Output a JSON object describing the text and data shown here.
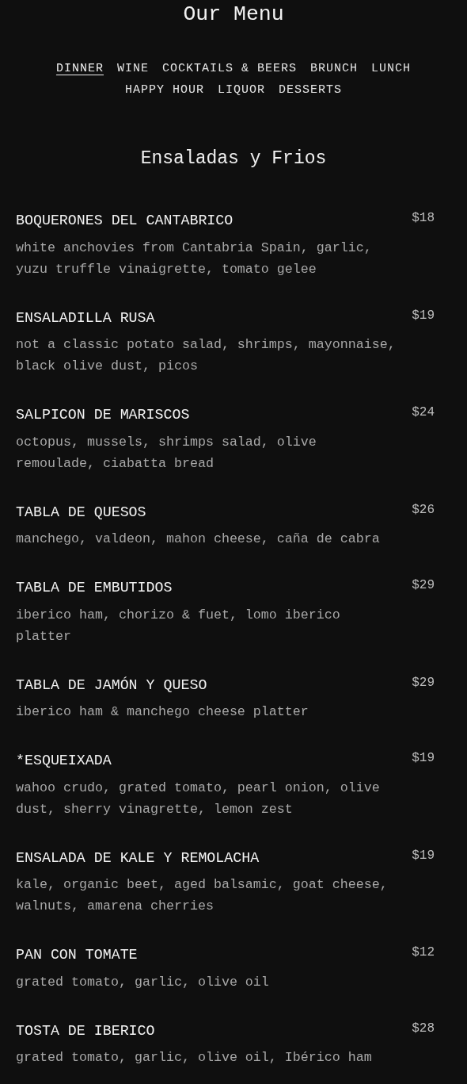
{
  "title": "Our Menu",
  "tabs": [
    {
      "label": "DINNER",
      "selected": true
    },
    {
      "label": "WINE",
      "selected": false
    },
    {
      "label": "COCKTAILS & BEERS",
      "selected": false
    },
    {
      "label": "BRUNCH",
      "selected": false
    },
    {
      "label": "LUNCH",
      "selected": false
    },
    {
      "label": "HAPPY HOUR",
      "selected": false
    },
    {
      "label": "LIQUOR",
      "selected": false
    },
    {
      "label": "DESSERTS",
      "selected": false
    }
  ],
  "section": {
    "heading": "Ensaladas y Frios",
    "items": [
      {
        "name": "BOQUERONES DEL CANTABRICO",
        "price": "$18",
        "description": "white anchovies from Cantabria Spain, garlic, yuzu truffle vinaigrette, tomato gelee"
      },
      {
        "name": "ENSALADILLA RUSA",
        "price": "$19",
        "description": "not a classic potato salad, shrimps, mayonnaise, black olive dust, picos"
      },
      {
        "name": "SALPICON DE MARISCOS",
        "price": "$24",
        "description": "octopus, mussels, shrimps salad, olive remoulade, ciabatta bread"
      },
      {
        "name": "TABLA DE QUESOS",
        "price": "$26",
        "description": "manchego, valdeon, mahon cheese, caña de cabra"
      },
      {
        "name": "TABLA DE EMBUTIDOS",
        "price": "$29",
        "description": "iberico ham, chorizo & fuet, lomo iberico platter"
      },
      {
        "name": "TABLA DE JAMÓN Y QUESO",
        "price": "$29",
        "description": "iberico ham & manchego cheese platter"
      },
      {
        "name": "*ESQUEIXADA",
        "price": "$19",
        "description": "wahoo crudo, grated tomato, pearl onion, olive dust, sherry vinagrette, lemon zest"
      },
      {
        "name": "ENSALADA DE KALE Y REMOLACHA",
        "price": "$19",
        "description": "kale, organic beet, aged balsamic, goat cheese, walnuts, amarena cherries"
      },
      {
        "name": "PAN CON TOMATE",
        "price": "$12",
        "description": "grated tomato, garlic, olive oil"
      },
      {
        "name": "TOSTA DE IBERICO",
        "price": "$28",
        "description": "grated tomato, garlic, olive oil, Ibérico ham"
      }
    ]
  }
}
